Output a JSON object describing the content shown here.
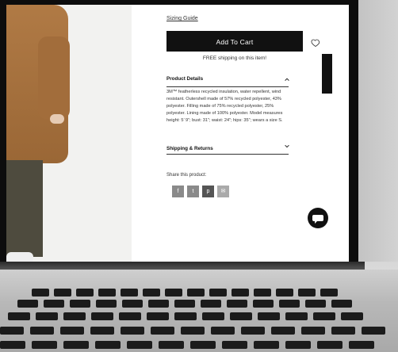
{
  "product_page": {
    "sizing_guide": "Sizing Guide",
    "add_to_cart": "Add To Cart",
    "free_shipping": "FREE shipping on this item!",
    "product_details": {
      "title": "Product Details",
      "description": "3M™ featherless recycled insulation, water repellent, wind resistant. Outershell made of 57% recycled polyester, 43% polyester. Filling made of 75% recycled polyester, 25% polyester. Lining made of 100% polyester. Model measures height: 5’ 9”; bust: 31”; waist: 24”; hips: 35”; wears a size S."
    },
    "shipping_returns": {
      "title": "Shipping & Returns"
    },
    "share": {
      "label": "Share this product:",
      "icons": [
        "facebook-icon",
        "twitter-icon",
        "pinterest-icon",
        "email-icon"
      ]
    },
    "feedback_tab": "Feedback"
  },
  "colors": {
    "cta": "#111111",
    "share_icon_bg": "#8a8a8a",
    "coat": "#b07a45"
  }
}
